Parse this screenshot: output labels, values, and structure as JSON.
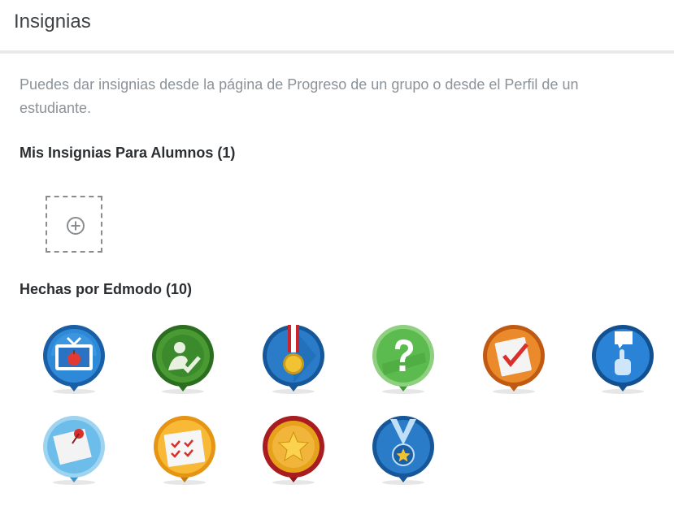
{
  "header": {
    "title": "Insignias"
  },
  "intro": {
    "text": "Puedes dar insignias desde la página de Progreso de un grupo o desde el Perfil de un estudiante."
  },
  "my_badges": {
    "heading": "Mis Insignias Para Alumnos (1)",
    "add_icon": "plus-circle-icon"
  },
  "edmodo_badges": {
    "heading": "Hechas por Edmodo (10)",
    "items": [
      {
        "icon": "tv-apple-badge-icon",
        "color": "#1f78c8"
      },
      {
        "icon": "person-check-badge-icon",
        "color": "#3f8f2e"
      },
      {
        "icon": "medal-badge-icon",
        "color": "#1f6fb8"
      },
      {
        "icon": "question-badge-icon",
        "color": "#52b548"
      },
      {
        "icon": "checklist-badge-icon",
        "color": "#e3731b"
      },
      {
        "icon": "raised-hand-badge-icon",
        "color": "#1d74c6"
      },
      {
        "icon": "pinned-note-badge-icon",
        "color": "#5fb7e8"
      },
      {
        "icon": "calendar-badge-icon",
        "color": "#f0a020"
      },
      {
        "icon": "star-badge-icon",
        "color": "#c0262a"
      },
      {
        "icon": "star-medal-badge-icon",
        "color": "#1f6fb8"
      }
    ]
  }
}
